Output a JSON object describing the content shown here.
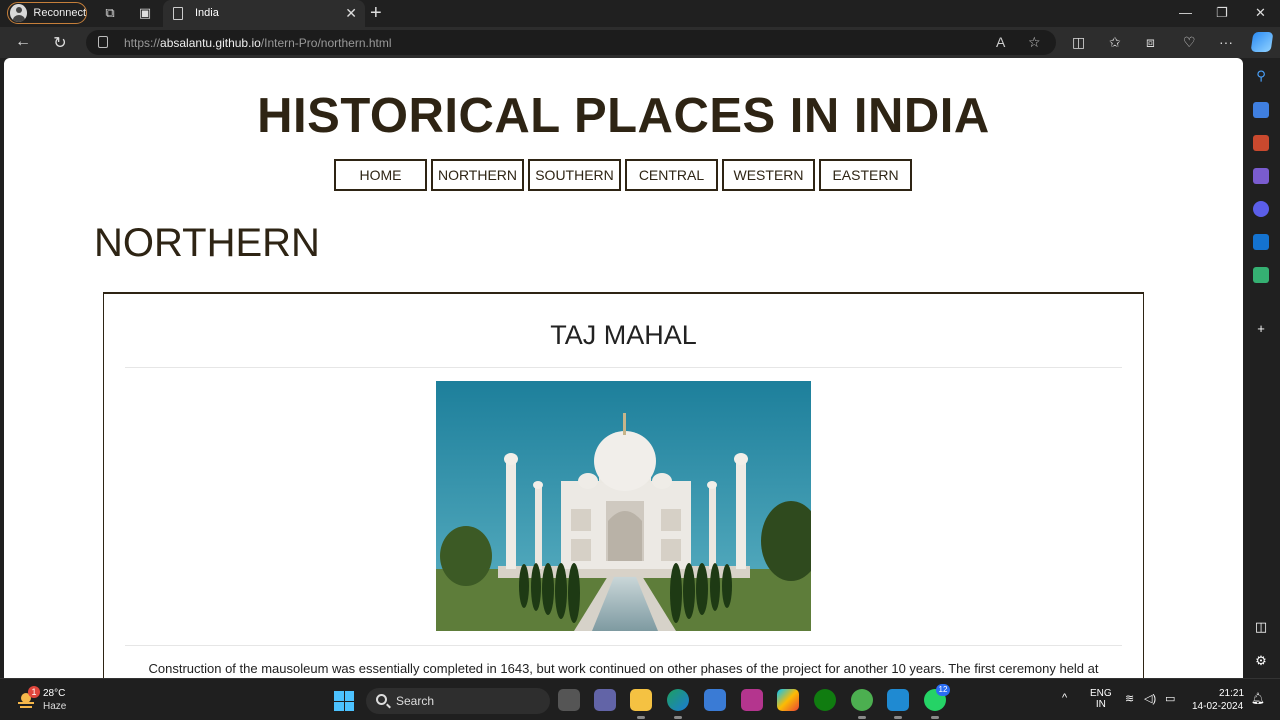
{
  "browser": {
    "reconnect_label": "Reconnect",
    "tab_title": "India",
    "url_prefix": "https://",
    "url_host": "absalantu.github.io",
    "url_path": "/Intern-Pro/northern.html"
  },
  "site": {
    "title": "HISTORICAL PLACES IN INDIA",
    "nav": [
      "HOME",
      "NORTHERN",
      "SOUTHERN",
      "CENTRAL",
      "WESTERN",
      "EASTERN"
    ],
    "section_heading": "NORTHERN",
    "card": {
      "title": "TAJ MAHAL",
      "text": "Construction of the mausoleum was essentially completed in 1643, but work continued on other phases of the project for another 10 years. The first ceremony held at"
    }
  },
  "taskbar": {
    "weather_badge": "1",
    "temperature": "28°C",
    "weather": "Haze",
    "search_label": "Search",
    "whatsapp_badge": "12",
    "lang_line1": "ENG",
    "lang_line2": "IN",
    "time": "21:21",
    "date": "14-02-2024"
  },
  "colors": {
    "accent_brown": "#2e2414",
    "edge_chrome": "#202020",
    "reconnect_border": "#c67f3a"
  }
}
